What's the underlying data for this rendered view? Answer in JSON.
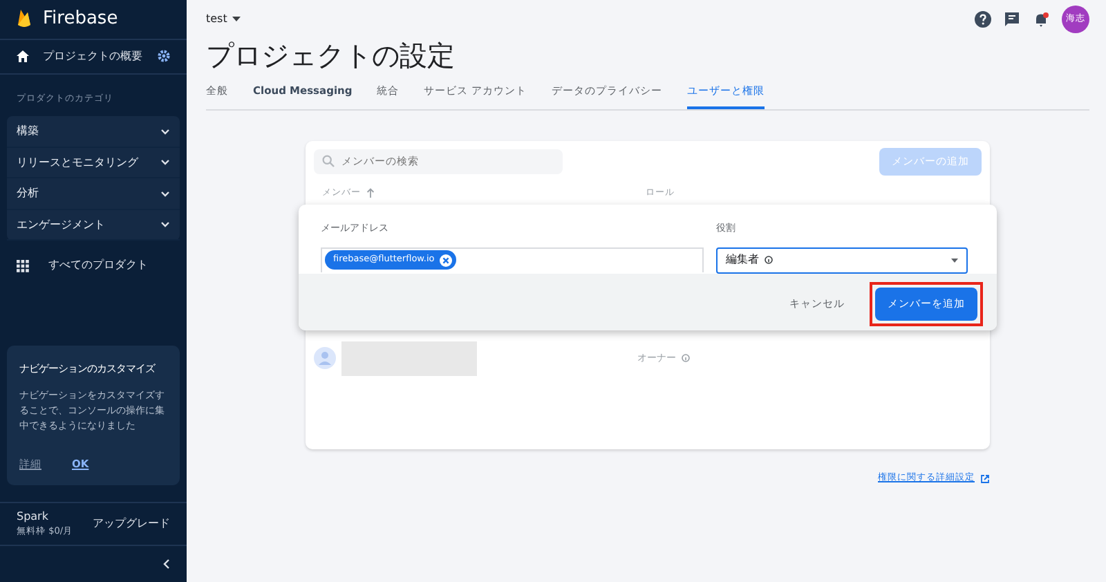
{
  "sidebar": {
    "brand": "Firebase",
    "overview": "プロジェクトの概要",
    "category_heading": "プロダクトのカテゴリ",
    "categories": [
      {
        "label": "構築",
        "expanded": false
      },
      {
        "label": "リリースとモニタリング",
        "expanded": false
      },
      {
        "label": "分析",
        "expanded": false
      },
      {
        "label": "エンゲージメント",
        "expanded": false
      }
    ],
    "all_products": "すべてのプロダクト",
    "tip": {
      "title": "ナビゲーションのカスタマイズ",
      "body": "ナビゲーションをカスタマイズすることで、コンソールの操作に集中できるようになりました",
      "actions": [
        "詳細",
        "OK"
      ]
    },
    "plan": {
      "name": "Spark",
      "price": "無料枠 $0/月",
      "upgrade": "アップグレード"
    }
  },
  "header": {
    "project": "test",
    "avatar": "海志",
    "notification": true
  },
  "page_title": "プロジェクトの設定",
  "tabs": [
    {
      "label": "全般",
      "selected": false
    },
    {
      "label": "Cloud Messaging",
      "selected": false
    },
    {
      "label": "統合",
      "selected": false
    },
    {
      "label": "サービス アカウント",
      "selected": false
    },
    {
      "label": "データのプライバシー",
      "selected": false
    },
    {
      "label": "ユーザーと権限",
      "selected": true
    }
  ],
  "members": {
    "search_placeholder": "メンバーの検索",
    "add_button": {
      "label": "メンバーの追加",
      "disabled": true
    },
    "columns": [
      "メンバー",
      "ロール"
    ],
    "rows": [
      {
        "role": "オーナー"
      }
    ]
  },
  "dialog": {
    "email_label": "メールアドレス",
    "chips": [
      "firebase@flutterflow.io"
    ],
    "role_label": "役割",
    "role_value": "編集者",
    "cancel": "キャンセル",
    "submit": {
      "label": "メンバーを追加",
      "highlighted": true
    }
  },
  "advanced_link": "権限に関する詳細設定"
}
